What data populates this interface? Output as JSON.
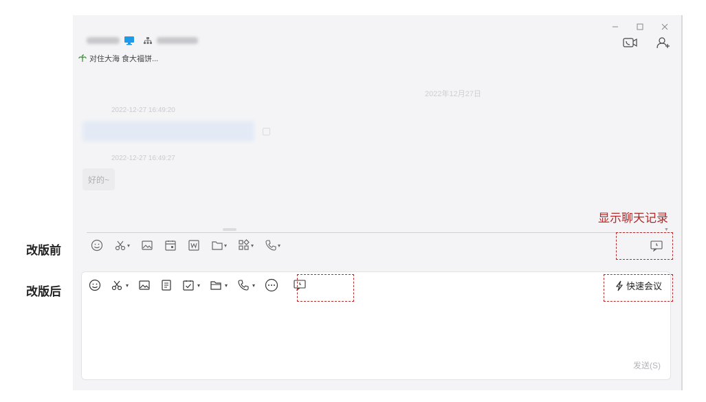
{
  "window": {
    "minimize_icon": "minimize-icon",
    "maximize_icon": "maximize-icon",
    "close_icon": "close-icon"
  },
  "header": {
    "contact_name": "",
    "status_text": "对住大海 食大福饼...",
    "video_call_icon": "video-call-icon",
    "add_member_icon": "add-member-icon"
  },
  "chat": {
    "date_separator": "2022年12月27日",
    "messages": [
      {
        "timestamp": "2022-12-27 16:49:20",
        "text": ""
      },
      {
        "timestamp": "2022-12-27 16:49:27",
        "text": "好的~"
      }
    ]
  },
  "annotations": {
    "before_label": "改版前",
    "after_label": "改版后",
    "history_label": "显示聊天记录",
    "accent_color": "#b12a2a"
  },
  "old_toolbar": {
    "items": [
      "emoji-icon",
      "scissors-icon",
      "image-icon",
      "calendar-icon",
      "word-doc-icon",
      "folder-icon",
      "apps-icon",
      "phone-icon"
    ],
    "history_icon": "chat-history-icon"
  },
  "new_toolbar": {
    "items": [
      "emoji-icon",
      "scissors-icon",
      "image-icon",
      "document-icon",
      "task-icon",
      "folder-icon",
      "phone-icon",
      "more-icon",
      "chat-history-icon"
    ],
    "meeting_label": "快速会议",
    "send_label": "发送(S)"
  }
}
